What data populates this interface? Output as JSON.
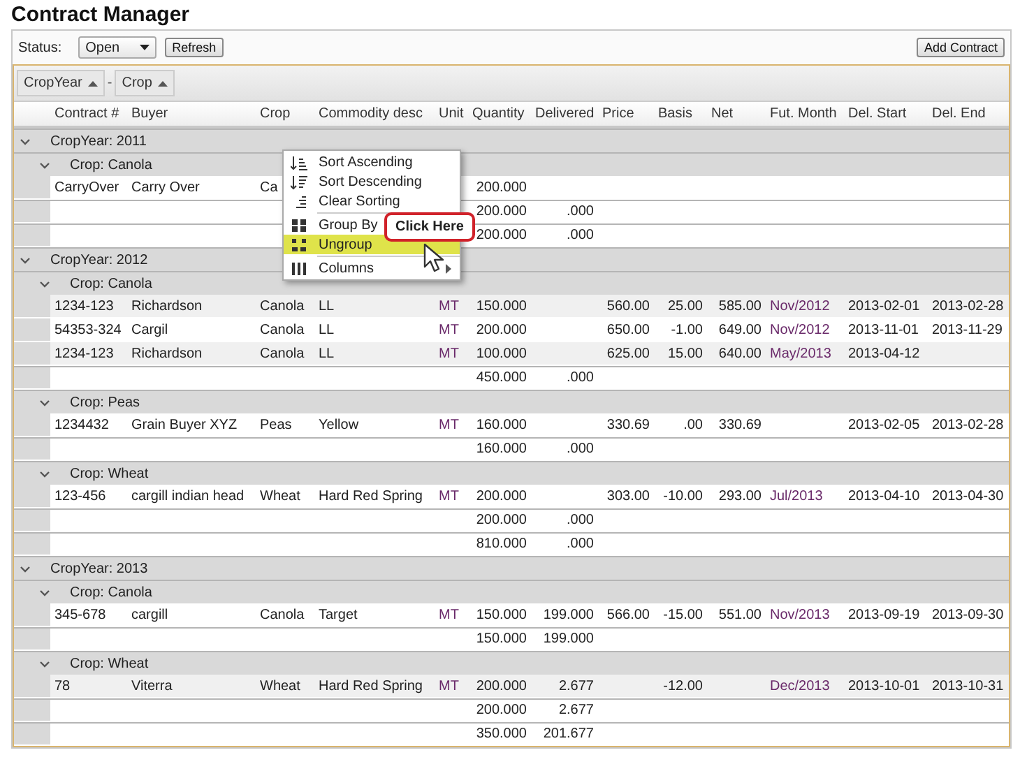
{
  "title": "Contract Manager",
  "toolbar": {
    "status_label": "Status:",
    "status_value": "Open",
    "refresh": "Refresh",
    "add": "Add Contract"
  },
  "group_chips": [
    {
      "label": "CropYear",
      "sorted_ascending": true
    },
    {
      "label": "Crop",
      "sorted_ascending": true
    }
  ],
  "chip_separator": "-",
  "columns": [
    "Contract #",
    "Buyer",
    "Crop",
    "Commodity desc",
    "Unit",
    "Quantity",
    "Delivered",
    "Price",
    "Basis",
    "Net",
    "Fut. Month",
    "Del. Start",
    "Del. End"
  ],
  "groups": [
    {
      "label": "CropYear: 2011",
      "expanded": true,
      "subgroups": [
        {
          "label": "Crop: Canola",
          "expanded": true,
          "rows": [
            {
              "shaded": false,
              "cells": [
                "CarryOver",
                "Carry Over",
                "Ca",
                "",
                "",
                "200.000",
                "",
                "",
                "",
                "",
                "",
                "",
                ""
              ]
            }
          ],
          "totals": [
            "200.000",
            ".000"
          ]
        }
      ],
      "totals": [
        "200.000",
        ".000"
      ]
    },
    {
      "label": "CropYear: 2012",
      "expanded": true,
      "subgroups": [
        {
          "label": "Crop: Canola",
          "expanded": true,
          "rows": [
            {
              "shaded": true,
              "cells": [
                "1234-123",
                "Richardson",
                "Canola",
                "LL",
                "MT",
                "150.000",
                "",
                "560.00",
                "25.00",
                "585.00",
                "Nov/2012",
                "2013-02-01",
                "2013-02-28"
              ]
            },
            {
              "shaded": false,
              "cells": [
                "54353-324",
                "Cargil",
                "Canola",
                "LL",
                "MT",
                "200.000",
                "",
                "650.00",
                "-1.00",
                "649.00",
                "Nov/2012",
                "2013-11-01",
                "2013-11-29"
              ]
            },
            {
              "shaded": true,
              "cells": [
                "1234-123",
                "Richardson",
                "Canola",
                "LL",
                "MT",
                "100.000",
                "",
                "625.00",
                "15.00",
                "640.00",
                "May/2013",
                "2013-04-12",
                ""
              ]
            }
          ],
          "totals": [
            "450.000",
            ".000"
          ]
        },
        {
          "label": "Crop: Peas",
          "expanded": true,
          "rows": [
            {
              "shaded": false,
              "cells": [
                "1234432",
                "Grain Buyer XYZ",
                "Peas",
                "Yellow",
                "MT",
                "160.000",
                "",
                "330.69",
                ".00",
                "330.69",
                "",
                "2013-02-05",
                "2013-02-28"
              ]
            }
          ],
          "totals": [
            "160.000",
            ".000"
          ]
        },
        {
          "label": "Crop: Wheat",
          "expanded": true,
          "rows": [
            {
              "shaded": false,
              "cells": [
                "123-456",
                "cargill indian head",
                "Wheat",
                "Hard Red Spring",
                "MT",
                "200.000",
                "",
                "303.00",
                "-10.00",
                "293.00",
                "Jul/2013",
                "2013-04-10",
                "2013-04-30"
              ]
            }
          ],
          "totals": [
            "200.000",
            ".000"
          ]
        }
      ],
      "totals": [
        "810.000",
        ".000"
      ]
    },
    {
      "label": "CropYear: 2013",
      "expanded": true,
      "subgroups": [
        {
          "label": "Crop: Canola",
          "expanded": true,
          "rows": [
            {
              "shaded": false,
              "cells": [
                "345-678",
                "cargill",
                "Canola",
                "Target",
                "MT",
                "150.000",
                "199.000",
                "566.00",
                "-15.00",
                "551.00",
                "Nov/2013",
                "2013-09-19",
                "2013-09-30"
              ]
            }
          ],
          "totals": [
            "150.000",
            "199.000"
          ]
        },
        {
          "label": "Crop: Wheat",
          "expanded": true,
          "rows": [
            {
              "shaded": true,
              "cells": [
                "78",
                "Viterra",
                "Wheat",
                "Hard Red Spring",
                "MT",
                "200.000",
                "2.677",
                "",
                "-12.00",
                "",
                "Dec/2013",
                "2013-10-01",
                "2013-10-31"
              ]
            }
          ],
          "totals": [
            "200.000",
            "2.677"
          ]
        }
      ],
      "totals": [
        "350.000",
        "201.677"
      ]
    }
  ],
  "context_menu": {
    "items": [
      {
        "label": "Sort Ascending",
        "kind": "sort-asc",
        "selected": false
      },
      {
        "label": "Sort Descending",
        "kind": "sort-desc",
        "selected": false
      },
      {
        "label": "Clear Sorting",
        "kind": "clear-sort",
        "selected": false
      },
      {
        "label": "Group By",
        "kind": "group",
        "selected": false,
        "separator_before": true
      },
      {
        "label": "Ungroup",
        "kind": "ungroup",
        "selected": true
      },
      {
        "label": "Columns",
        "kind": "columns",
        "selected": false,
        "separator_before": true,
        "submenu": true
      }
    ]
  },
  "callout": {
    "text": "Click Here"
  }
}
